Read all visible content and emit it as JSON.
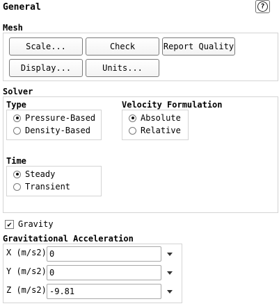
{
  "panel": {
    "title": "General",
    "help_label": "?"
  },
  "mesh": {
    "label": "Mesh",
    "buttons": {
      "scale": "Scale...",
      "check": "Check",
      "report_quality": "Report Quality",
      "display": "Display...",
      "units": "Units..."
    }
  },
  "solver": {
    "label": "Solver",
    "type": {
      "label": "Type",
      "options": [
        {
          "label": "Pressure-Based",
          "selected": true
        },
        {
          "label": "Density-Based",
          "selected": false
        }
      ]
    },
    "velocity": {
      "label": "Velocity Formulation",
      "options": [
        {
          "label": "Absolute",
          "selected": true
        },
        {
          "label": "Relative",
          "selected": false
        }
      ]
    },
    "time": {
      "label": "Time",
      "options": [
        {
          "label": "Steady",
          "selected": true
        },
        {
          "label": "Transient",
          "selected": false
        }
      ]
    }
  },
  "gravity": {
    "label": "Gravity",
    "checked": true,
    "check_glyph": "✔"
  },
  "gravitational_acceleration": {
    "label": "Gravitational Acceleration",
    "x": {
      "label": "X (m/s2)",
      "value": "0"
    },
    "y": {
      "label": "Y (m/s2)",
      "value": "0"
    },
    "z": {
      "label": "Z (m/s2)",
      "value": "-9.81"
    }
  },
  "icons": {
    "help": "help-icon",
    "dropdown": "chevron-down-icon",
    "check": "check-icon"
  }
}
